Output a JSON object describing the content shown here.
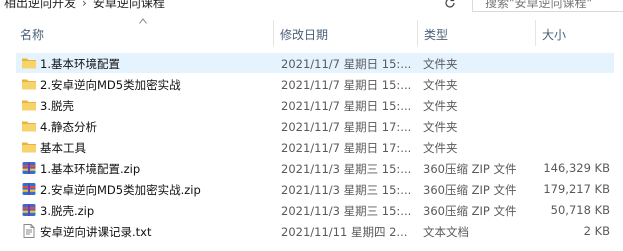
{
  "breadcrumb": {
    "parent": "相出逆向开发",
    "current": "安卓逆向课程"
  },
  "search": {
    "placeholder": "搜索\"安卓逆向课程\""
  },
  "columns": {
    "name": "名称",
    "date": "修改日期",
    "type": "类型",
    "size": "大小"
  },
  "files": [
    {
      "name": "1.基本环境配置",
      "date": "2021/11/7 星期日 15:...",
      "type": "文件夹",
      "size": "",
      "icon": "folder-icon",
      "selected": true
    },
    {
      "name": "2.安卓逆向MD5类加密实战",
      "date": "2021/11/7 星期日 15:...",
      "type": "文件夹",
      "size": "",
      "icon": "folder-icon",
      "selected": false
    },
    {
      "name": "3.脱壳",
      "date": "2021/11/7 星期日 15:...",
      "type": "文件夹",
      "size": "",
      "icon": "folder-icon",
      "selected": false
    },
    {
      "name": "4.静态分析",
      "date": "2021/11/7 星期日 17:...",
      "type": "文件夹",
      "size": "",
      "icon": "folder-icon",
      "selected": false
    },
    {
      "name": "基本工具",
      "date": "2021/11/7 星期日 17:...",
      "type": "文件夹",
      "size": "",
      "icon": "folder-icon",
      "selected": false
    },
    {
      "name": "1.基本环境配置.zip",
      "date": "2021/11/3 星期三 15:...",
      "type": "360压缩 ZIP 文件",
      "size": "146,329 KB",
      "icon": "zip-icon",
      "selected": false
    },
    {
      "name": "2.安卓逆向MD5类加密实战.zip",
      "date": "2021/11/3 星期三 15:...",
      "type": "360压缩 ZIP 文件",
      "size": "179,217 KB",
      "icon": "zip-icon",
      "selected": false
    },
    {
      "name": "3.脱壳.zip",
      "date": "2021/11/3 星期三 15:...",
      "type": "360压缩 ZIP 文件",
      "size": "50,718 KB",
      "icon": "zip-icon",
      "selected": false
    },
    {
      "name": "安卓逆向讲课记录.txt",
      "date": "2021/11/11 星期四 2...",
      "type": "文本文档",
      "size": "2 KB",
      "icon": "text-file-icon",
      "selected": false
    }
  ]
}
